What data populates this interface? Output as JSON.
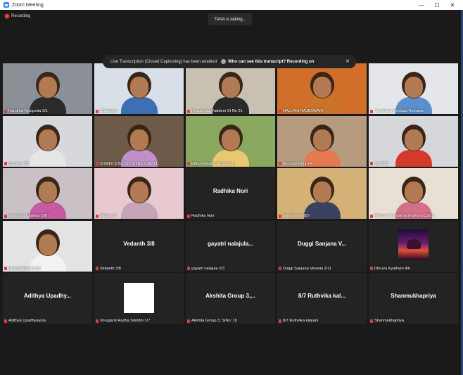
{
  "window": {
    "title": "Zoom Meeting",
    "minimize": "—",
    "maximize": "☐",
    "close": "✕"
  },
  "status": {
    "recording": "Recording",
    "talking": "TANA is talking..."
  },
  "banner": {
    "message": "Live Transcription (Closed Captioning) has been enabled",
    "link": "Who can see this transcript? Recording on",
    "close": "✕"
  },
  "tiles": [
    {
      "label": "Harsitha Telugunta 9/1",
      "video": true,
      "bg": "#8b8f96",
      "shirt": "#2b2b2b"
    },
    {
      "label": "Chanakya",
      "video": true,
      "bg": "#d9dfe6",
      "shirt": "#3e6fb3"
    },
    {
      "label": "Revant Sai Yaddem SI No 21",
      "video": true,
      "bg": "#c8c0b1",
      "shirt": "#2a2a2a"
    },
    {
      "label": "NALLANI RAJESWARI",
      "video": true,
      "bg": "#d06e2a",
      "shirt": "#c8752a"
    },
    {
      "label": "Chokkapu Venkata Ramana",
      "video": true,
      "bg": "#e4e6e9",
      "shirt": "#5b8fd0"
    },
    {
      "label": "hoshika 8/2",
      "video": true,
      "bg": "#d6d8dc",
      "shirt": "#e5e5e5"
    },
    {
      "label": "Srinidhi S.No 10 , Srinija S.No 11",
      "video": true,
      "bg": "#6e5a48",
      "shirt": "#c090c8"
    },
    {
      "label": "Ethamukkala, Narasaiah",
      "video": true,
      "bg": "#8aa860",
      "shirt": "#e8c870"
    },
    {
      "label": "Akul Sai Potti 14",
      "video": true,
      "bg": "#b79b7f",
      "shirt": "#e37a52"
    },
    {
      "label": "Jai 7/10",
      "video": true,
      "bg": "#d5d7da",
      "shirt": "#d33a2c"
    },
    {
      "label": "Vedanshi Chanda (3/8)",
      "video": true,
      "bg": "#c9c1c6",
      "shirt": "#c75aa0"
    },
    {
      "label": "Nihalya 6",
      "video": true,
      "bg": "#e7c9cf",
      "shirt": "#c6a6b6"
    },
    {
      "label": "Radhika Nori",
      "video": false,
      "bigName": "Radhika Nori"
    },
    {
      "label": "Geethamsh@5",
      "video": true,
      "bg": "#d4b277",
      "shirt": "#3b4160"
    },
    {
      "label": "Rehasri Gandikota (Kishora Cat) 9",
      "video": true,
      "bg": "#e8e0d4",
      "shirt": "#d56e8a"
    },
    {
      "label": "BHAVAGNA G 5/3",
      "video": true,
      "bg": "#e4e4e4",
      "shirt": "#f2f2f2"
    },
    {
      "label": "Vedanth 3/8",
      "video": false,
      "bigName": "Vedanth 3/8"
    },
    {
      "label": "gayatri nalajula 2/3",
      "video": false,
      "bigName": "gayatri nalajula..."
    },
    {
      "label": "Duggi Sanjana Vineeta 2/11",
      "video": false,
      "bigName": "Duggi Sanjana V..."
    },
    {
      "label": "Dhruva Kyatham 4/6",
      "video": false,
      "avatar": true
    },
    {
      "label": "Adithya Upadhyayula",
      "video": false,
      "bigName": "Adithya Upadhy..."
    },
    {
      "label": "Voruganti Radha Srinidhi 1/7",
      "video": false,
      "whiteBox": true
    },
    {
      "label": "Akshita Group 3, SINo: 10",
      "video": false,
      "bigName": "Akshita Group 3,..."
    },
    {
      "label": "8/7 Ruthvika kalyani",
      "video": false,
      "bigName": "8/7 Ruthvika kal..."
    },
    {
      "label": "Shanmukhapriya",
      "video": false,
      "bigName": "Shanmukhapriya"
    }
  ]
}
